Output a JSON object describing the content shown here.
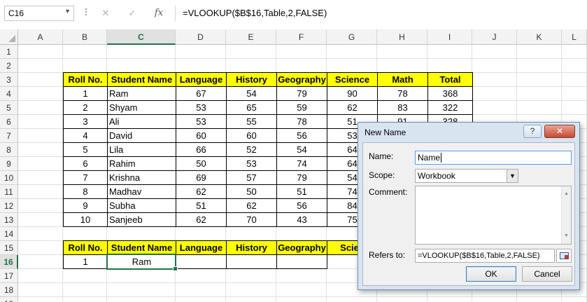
{
  "formula_bar": {
    "name_box": "C16",
    "name_box_dropdown": "▼",
    "cancel_symbol": "✕",
    "enter_symbol": "✓",
    "fx_symbol": "fx",
    "formula": "=VLOOKUP($B$16,Table,2,FALSE)"
  },
  "columns": [
    "A",
    "B",
    "C",
    "D",
    "E",
    "F",
    "G",
    "H",
    "I",
    "J",
    "K",
    "L"
  ],
  "rows": [
    "1",
    "2",
    "3",
    "4",
    "5",
    "6",
    "7",
    "8",
    "9",
    "10",
    "11",
    "12",
    "13",
    "14",
    "15",
    "16",
    "17",
    "18",
    "19"
  ],
  "selected_column": "C",
  "selected_row": "16",
  "table": {
    "headers": [
      "Roll No.",
      "Student Name",
      "Language",
      "History",
      "Geography",
      "Science",
      "Math",
      "Total"
    ],
    "rows": [
      [
        "1",
        "Ram",
        "67",
        "54",
        "79",
        "90",
        "78",
        "368"
      ],
      [
        "2",
        "Shyam",
        "53",
        "65",
        "59",
        "62",
        "83",
        "322"
      ],
      [
        "3",
        "Ali",
        "53",
        "55",
        "78",
        "51",
        "91",
        "328"
      ],
      [
        "4",
        "David",
        "60",
        "60",
        "56",
        "53",
        "",
        ""
      ],
      [
        "5",
        "Lila",
        "66",
        "52",
        "54",
        "64",
        "",
        ""
      ],
      [
        "6",
        "Rahim",
        "50",
        "53",
        "74",
        "64",
        "",
        ""
      ],
      [
        "7",
        "Krishna",
        "69",
        "57",
        "79",
        "54",
        "",
        ""
      ],
      [
        "8",
        "Madhav",
        "62",
        "50",
        "51",
        "74",
        "",
        ""
      ],
      [
        "9",
        "Subha",
        "51",
        "62",
        "56",
        "84",
        "",
        ""
      ],
      [
        "10",
        "Sanjeeb",
        "62",
        "70",
        "43",
        "75",
        "",
        ""
      ]
    ]
  },
  "lookup": {
    "headers": [
      "Roll No.",
      "Student Name",
      "Language",
      "History",
      "Geography",
      "Scien"
    ],
    "values": [
      "1",
      "Ram"
    ]
  },
  "dialog": {
    "title": "New Name",
    "help": "?",
    "close": "✕",
    "name_label": "Name:",
    "name_value": "Name",
    "scope_label": "Scope:",
    "scope_value": "Workbook",
    "comment_label": "Comment:",
    "refers_label": "Refers to:",
    "refers_value": "=VLOOKUP($B$16,Table,2,FALSE)",
    "ok": "OK",
    "cancel": "Cancel"
  },
  "colors": {
    "header_fill": "#ffff00",
    "selection": "#217346",
    "dialog_frame": "#d9e4f1"
  }
}
